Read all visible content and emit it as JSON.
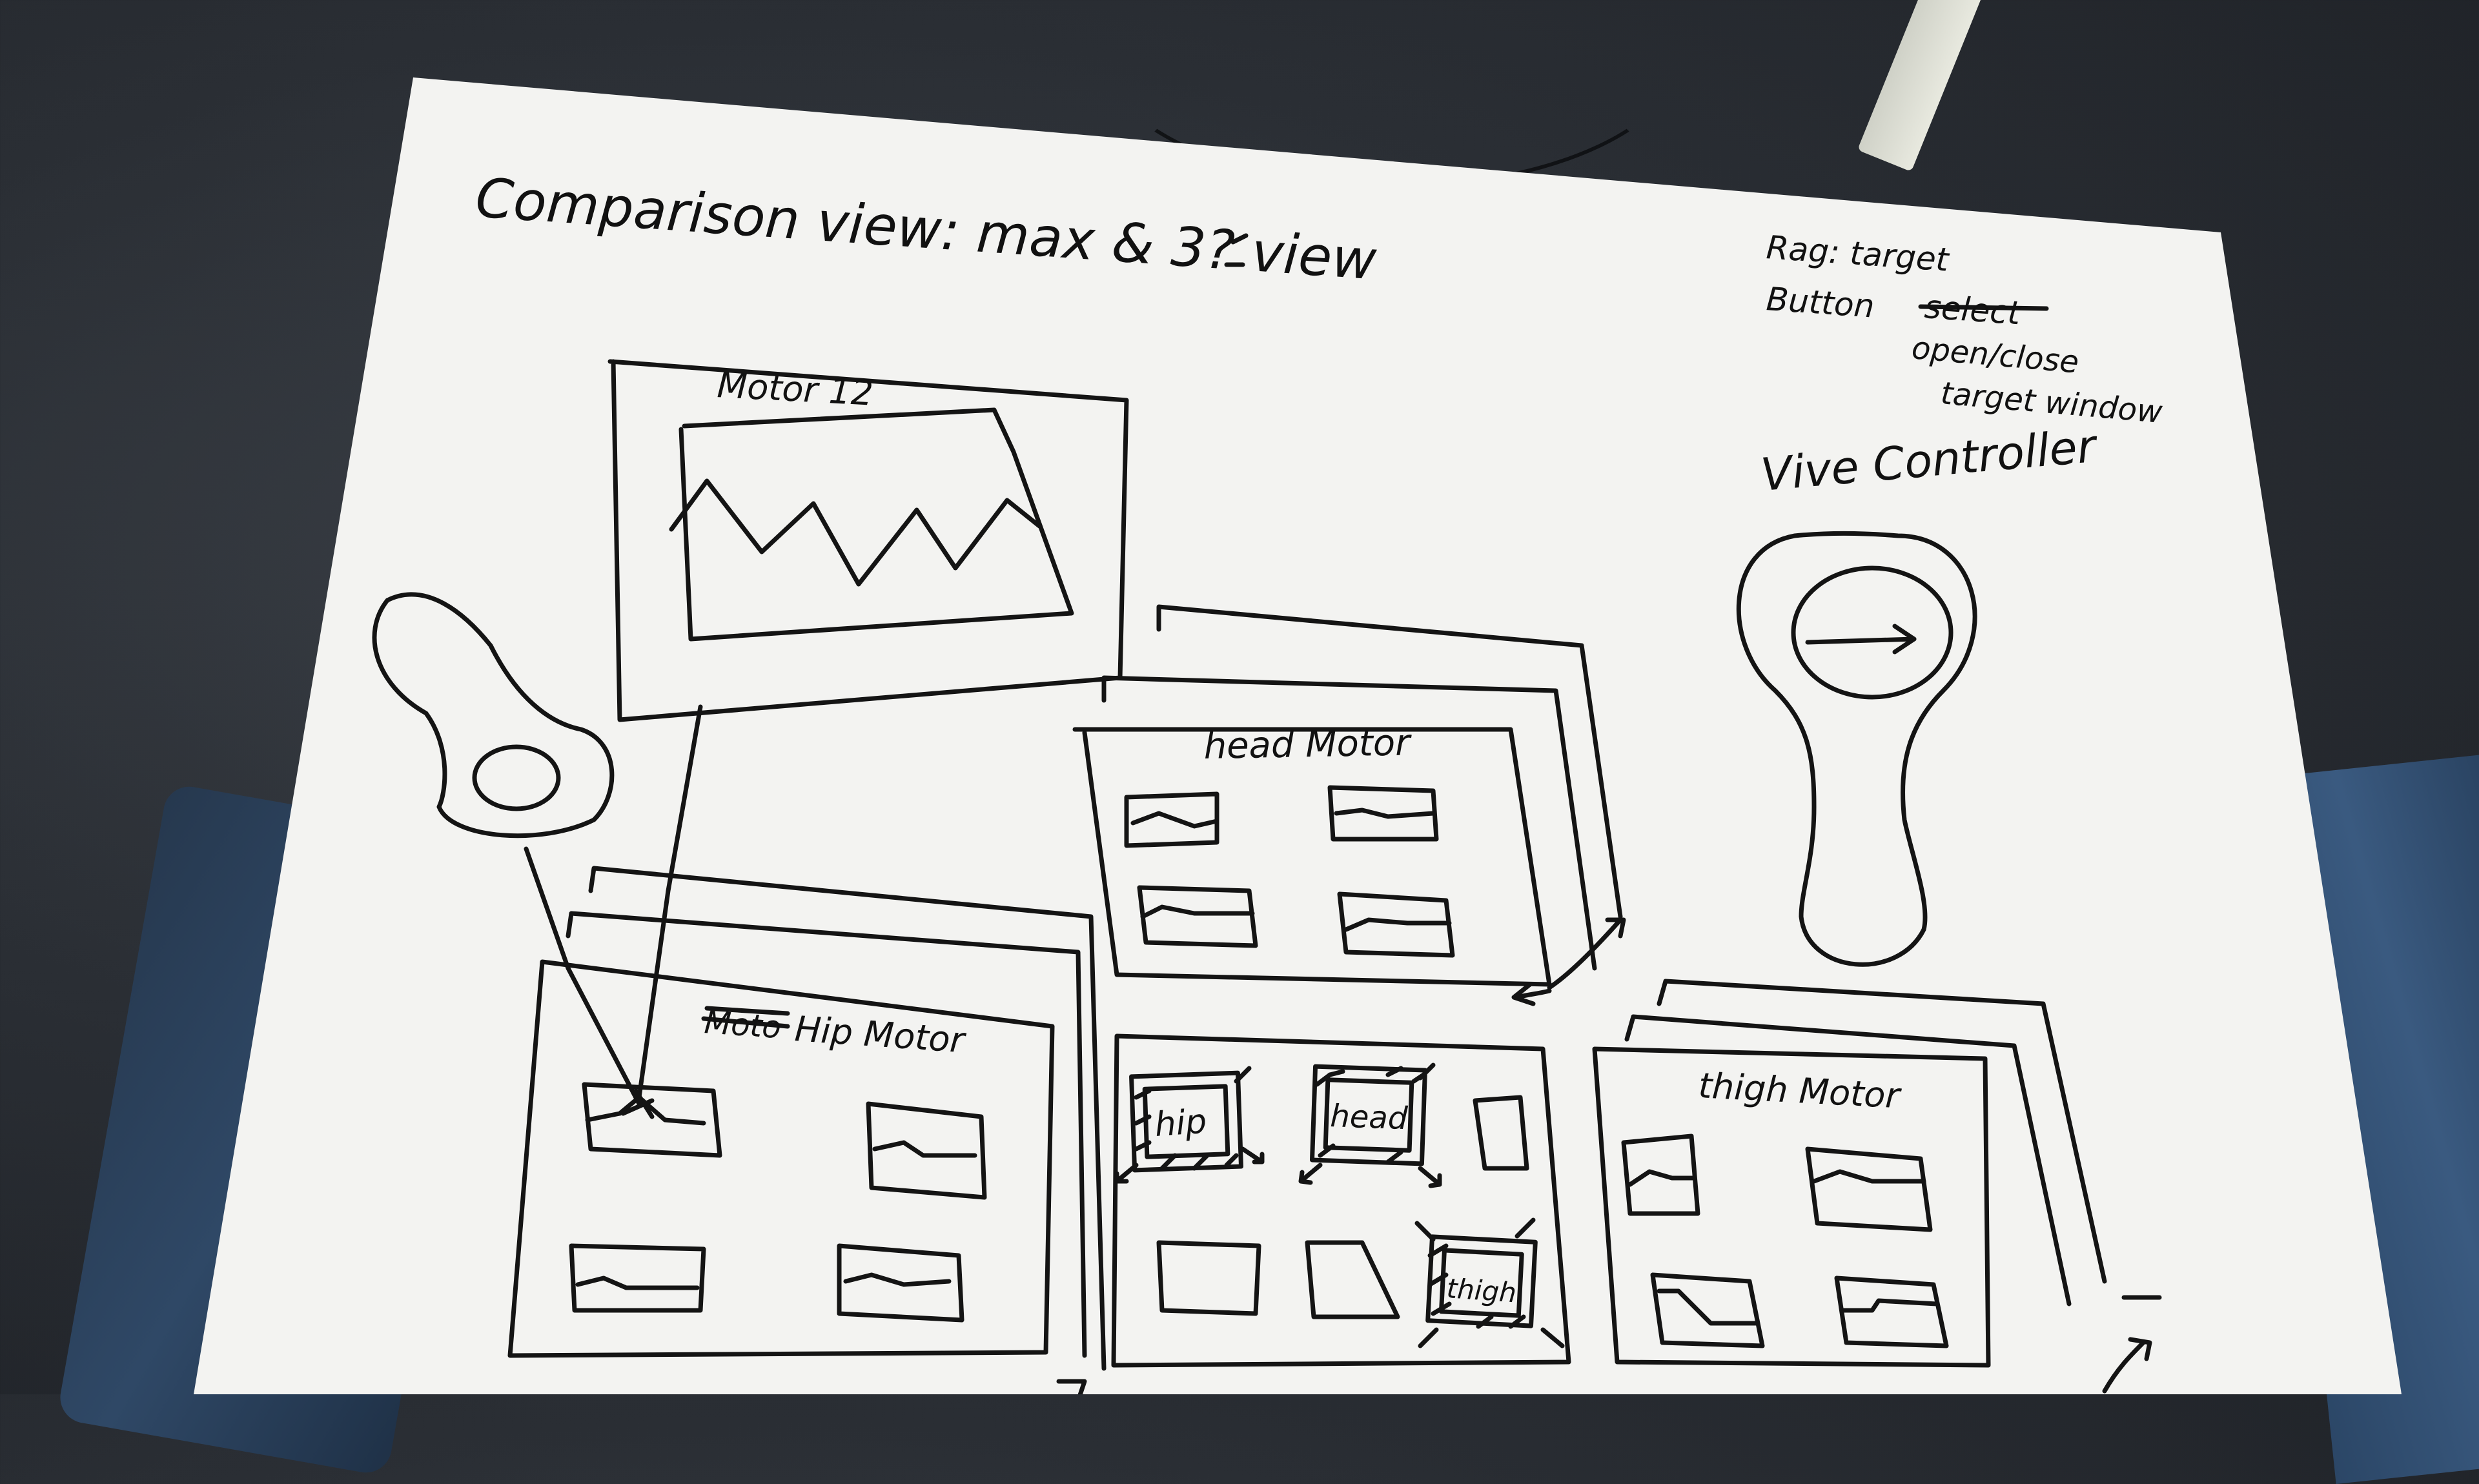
{
  "sketch": {
    "title": "Comparison view: max & 3? view",
    "legend": {
      "line1": "Rag: target",
      "line2": "Button",
      "line2_struck": "select",
      "line3": "open/close",
      "line4": "target window"
    },
    "controller_label": "Vive Controller",
    "large_window_title": "Motor 12",
    "head_window_title": "head Motor",
    "hip_window_title_struck": "Moto",
    "hip_window_title": "Hip Motor",
    "thigh_window_title": "thigh Motor",
    "target_tiles": [
      "hip",
      "head",
      "thigh"
    ]
  }
}
